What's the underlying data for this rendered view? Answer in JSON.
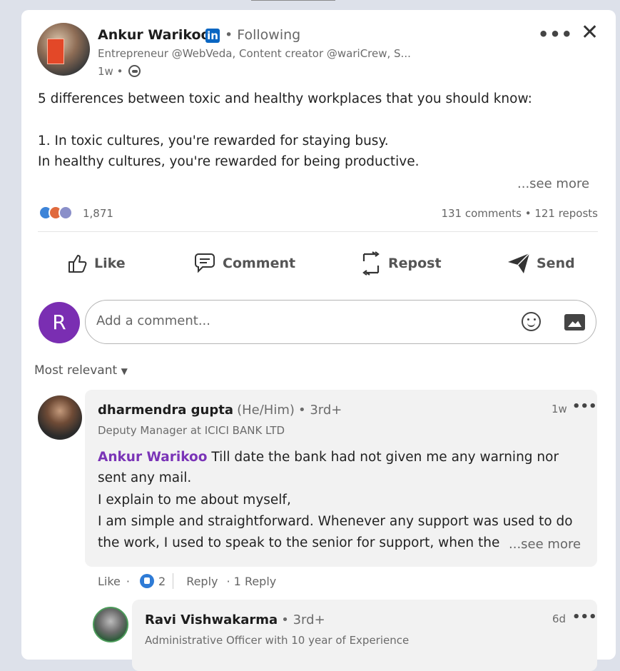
{
  "post": {
    "author": "Ankur Warikoo",
    "badge": "in",
    "following": "• Following",
    "headline": "Entrepreneur @WebVeda, Content creator @wariCrew, S...",
    "time": "1w •",
    "body_lines": [
      "5 differences between toxic and healthy workplaces that you should know:",
      "1. In toxic cultures, you're rewarded for staying busy.",
      "In healthy cultures, you're rewarded for being productive."
    ],
    "see_more": "...see more",
    "reaction_count": "1,871",
    "comments_reposts": "131 comments • 121 reposts"
  },
  "actions": {
    "like": "Like",
    "comment": "Comment",
    "repost": "Repost",
    "send": "Send"
  },
  "compose": {
    "avatar_letter": "R",
    "placeholder": "Add a comment..."
  },
  "sort_label": "Most relevant",
  "comment1": {
    "name": "dharmendra gupta",
    "pronouns": "(He/Him)",
    "degree": "• 3rd+",
    "subtitle": "Deputy Manager at ICICI BANK LTD",
    "time": "1w",
    "menu": "•••",
    "mention": "Ankur Warikoo",
    "line1": " Till date the bank had not given me any warning nor",
    "line2": "sent any mail.",
    "line3": "I explain to me about myself,",
    "line4": "I am simple and straightforward. Whenever any support was used to do",
    "line5": "the work, I used to speak to the senior for support, when the",
    "see_more": "...see more",
    "like": "Like",
    "dot": "·",
    "like_count": "2",
    "reply": "Reply",
    "reply_count": "· 1 Reply"
  },
  "reply1": {
    "name": "Ravi Vishwakarma",
    "degree": "• 3rd+",
    "subtitle": "Administrative Officer with 10 year of Experience",
    "time": "6d",
    "menu": "•••"
  },
  "header_menu": "•••",
  "close": "✕",
  "colors": {
    "linkedin_blue": "#0a66c2",
    "mention_purple": "#7a34b7",
    "avatar_purple": "#7a2eb2"
  }
}
